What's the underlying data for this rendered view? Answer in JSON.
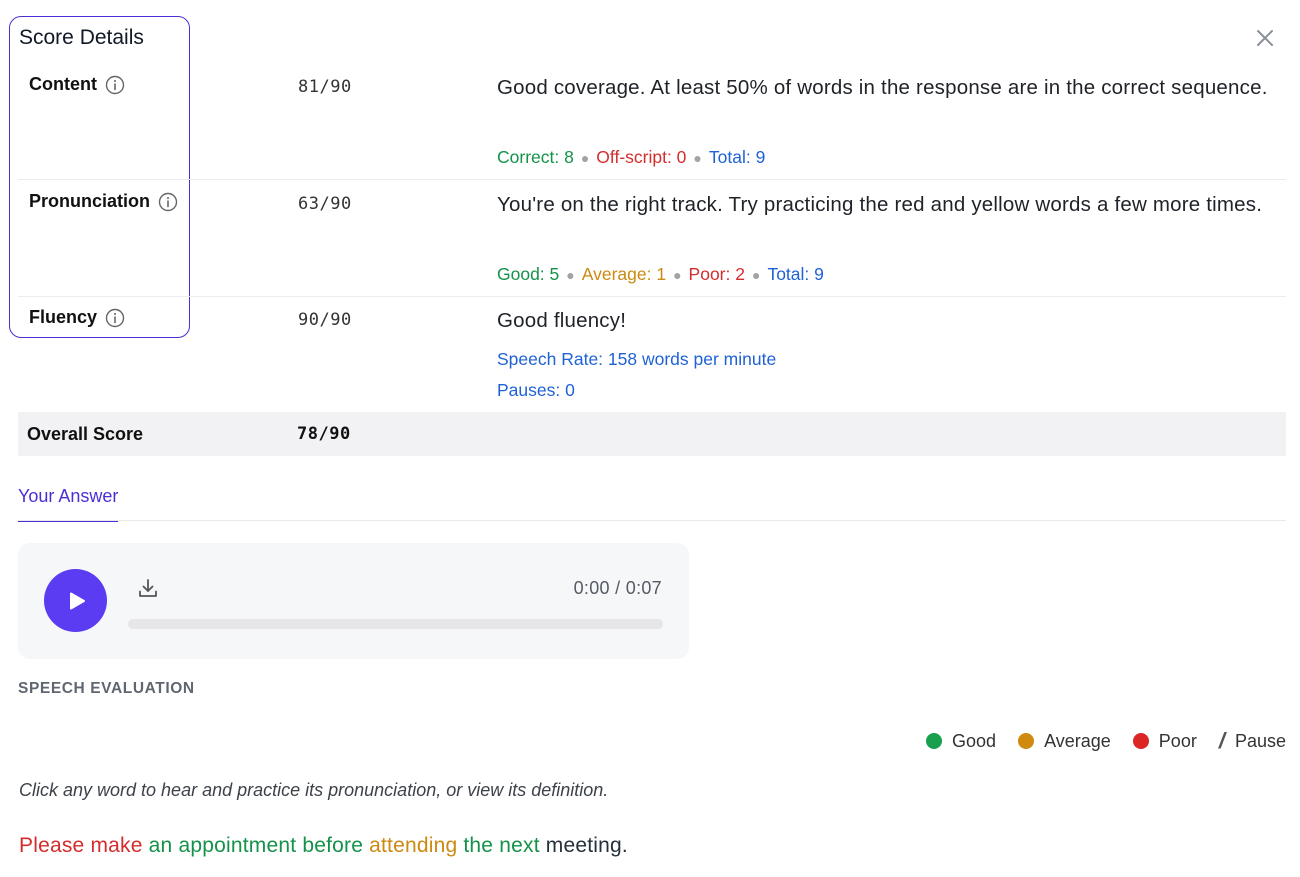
{
  "header": {
    "title": "Score Details",
    "close_icon": "close-icon"
  },
  "colors": {
    "accent": "#5b3cf2",
    "good": "#15924a",
    "average": "#cc8a10",
    "poor": "#d42d2d",
    "total": "#1f62d6"
  },
  "rows": [
    {
      "label": "Content",
      "score": "81/90",
      "description": "Good coverage. At least 50% of words in the response are in the correct sequence.",
      "stats": [
        "Correct: 8",
        "Off-script: 0",
        "Total: 9"
      ]
    },
    {
      "label": "Pronunciation",
      "score": "63/90",
      "description": "You're on the right track. Try practicing the red and yellow words a few more times.",
      "stats": [
        "Good: 5",
        "Average: 1",
        "Poor: 2",
        "Total: 9"
      ]
    },
    {
      "label": "Fluency",
      "score": "90/90",
      "description": "Good fluency!",
      "stats": [
        "Speech Rate: 158 words per minute",
        "Pauses: 0"
      ]
    }
  ],
  "overall": {
    "label": "Overall Score",
    "score": "78/90"
  },
  "tabs": [
    {
      "label": "Your Answer",
      "active": true
    }
  ],
  "player": {
    "time": "0:00 / 0:07",
    "progress": 0
  },
  "evaluation": {
    "section_label": "SPEECH EVALUATION",
    "legend": [
      "Good",
      "Average",
      "Poor",
      "Pause"
    ],
    "legend_pause_symbol": "/",
    "hint": "Click any word to hear and practice its pronunciation, or view its definition.",
    "sentence": [
      {
        "text": "Please",
        "rating": "poor"
      },
      {
        "text": "make",
        "rating": "poor"
      },
      {
        "text": "an",
        "rating": "good"
      },
      {
        "text": "appointment",
        "rating": "good"
      },
      {
        "text": "before",
        "rating": "good"
      },
      {
        "text": "attending",
        "rating": "average"
      },
      {
        "text": "the",
        "rating": "good"
      },
      {
        "text": "next",
        "rating": "good"
      },
      {
        "text": "meeting.",
        "rating": "neutral"
      }
    ]
  }
}
